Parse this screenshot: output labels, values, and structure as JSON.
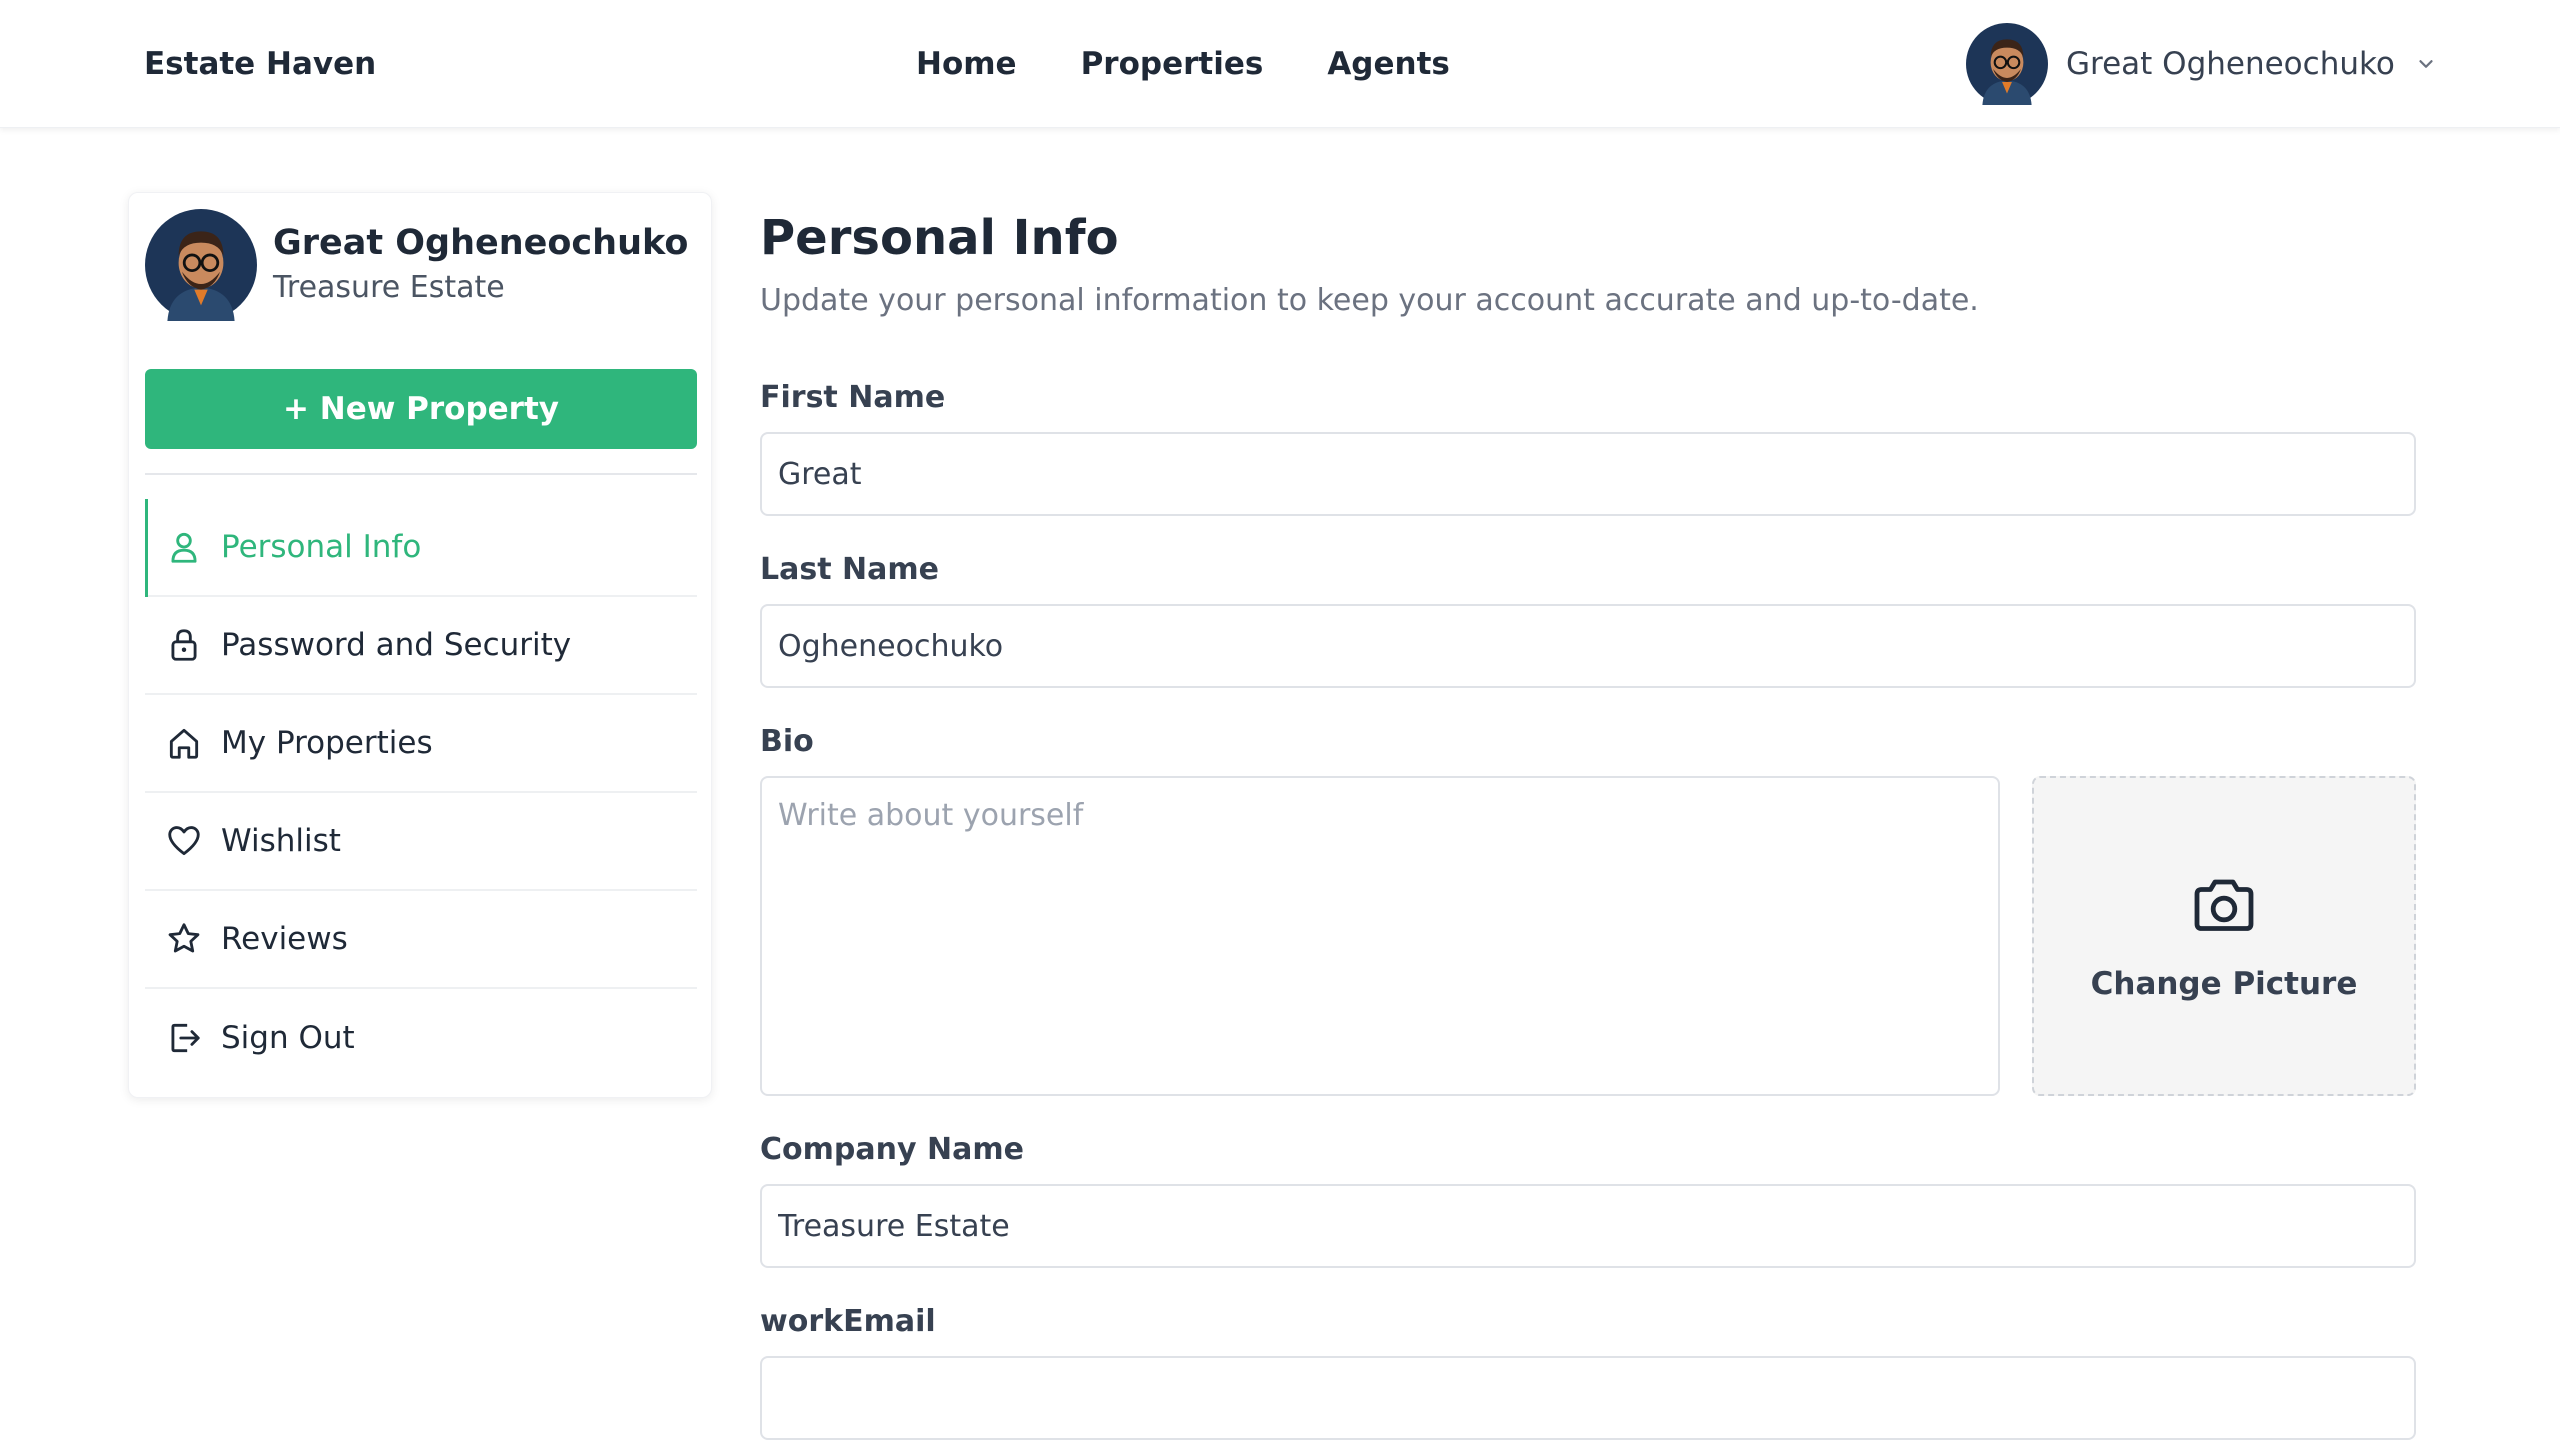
{
  "brand": {
    "name": "Estate Haven"
  },
  "nav": {
    "items": [
      "Home",
      "Properties",
      "Agents"
    ]
  },
  "user": {
    "name": "Great Ogheneochuko",
    "company": "Treasure Estate",
    "avatar_icon": "avatar-icon"
  },
  "sidebar": {
    "new_property_label": "+ New Property",
    "items": [
      {
        "label": "Personal Info",
        "icon": "user-icon",
        "active": true
      },
      {
        "label": "Password and Security",
        "icon": "lock-icon",
        "active": false
      },
      {
        "label": "My Properties",
        "icon": "home-icon",
        "active": false
      },
      {
        "label": "Wishlist",
        "icon": "heart-icon",
        "active": false
      },
      {
        "label": "Reviews",
        "icon": "star-icon",
        "active": false
      },
      {
        "label": "Sign Out",
        "icon": "sign-out-icon",
        "active": false
      }
    ]
  },
  "main": {
    "title": "Personal Info",
    "subtitle": "Update your personal information to keep your account accurate and up-to-date.",
    "fields": {
      "first_name": {
        "label": "First Name",
        "value": "Great"
      },
      "last_name": {
        "label": "Last Name",
        "value": "Ogheneochuko"
      },
      "bio": {
        "label": "Bio",
        "placeholder": "Write about yourself",
        "value": ""
      },
      "company_name": {
        "label": "Company Name",
        "value": "Treasure Estate"
      },
      "work_email": {
        "label": "workEmail",
        "value": ""
      }
    },
    "change_picture_label": "Change Picture"
  },
  "colors": {
    "accent": "#2fb67c",
    "text": "#1f2937",
    "muted": "#6b7280",
    "border": "#dfe2e7"
  }
}
